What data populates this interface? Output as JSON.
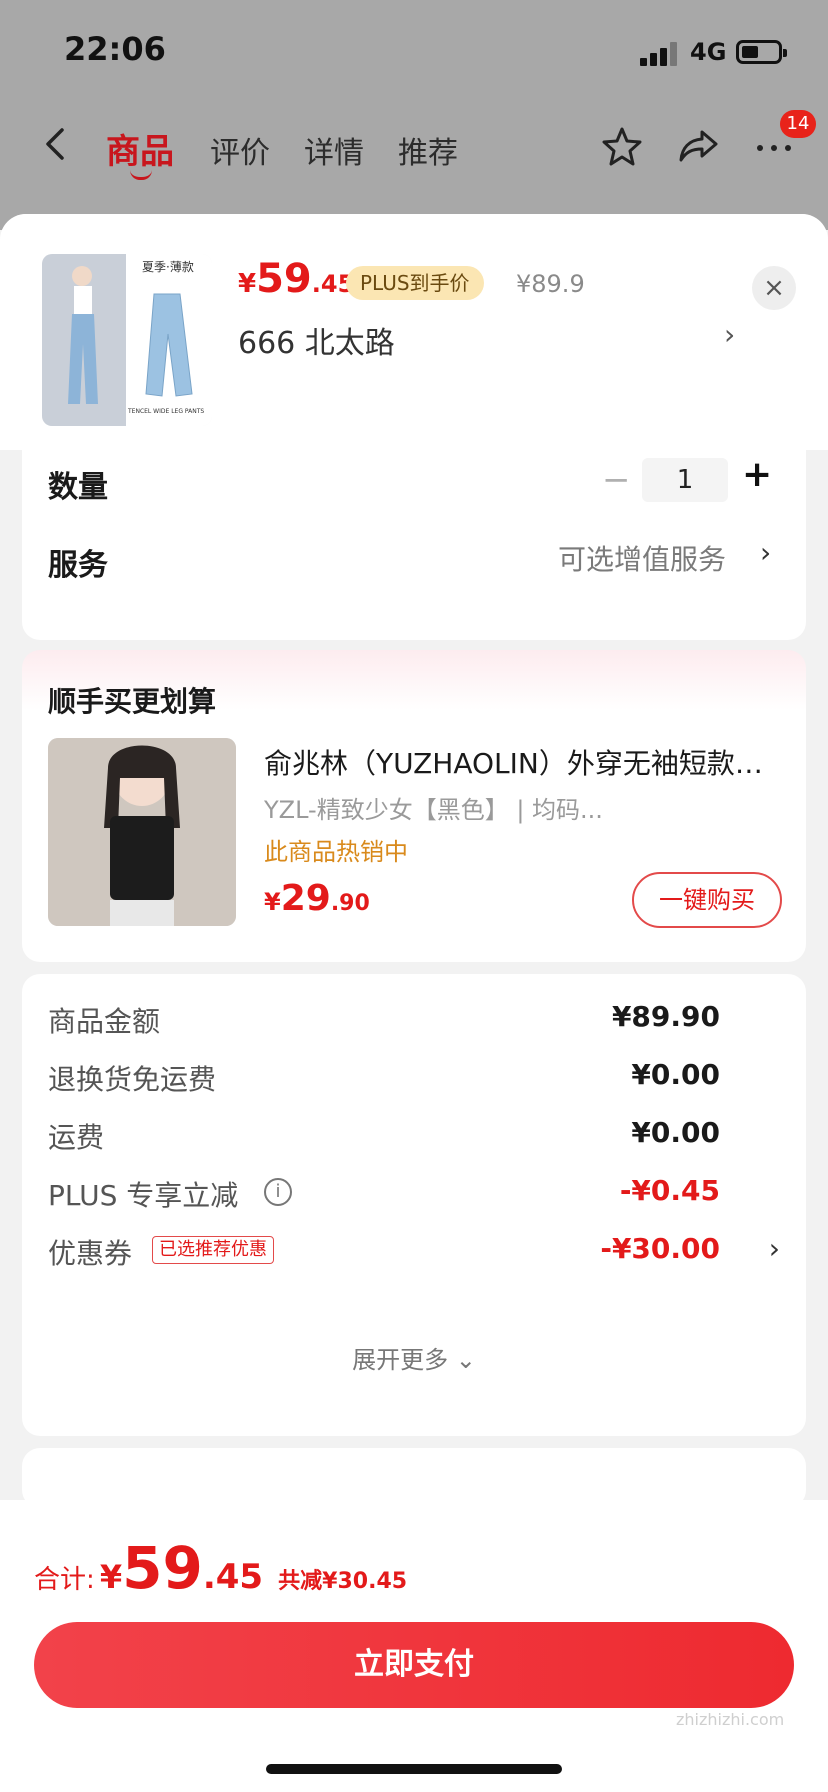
{
  "status": {
    "time": "22:06",
    "network": "4G"
  },
  "nav": {
    "tabs": [
      "商品",
      "评价",
      "详情",
      "推荐"
    ],
    "badge": "14"
  },
  "product": {
    "thumb_caption": "夏季·薄款",
    "thumb_sub": "TENCEL WIDE LEG PANTS",
    "price_currency": "¥",
    "price_int": "59",
    "price_dec": ".45",
    "plus_tag": "PLUS到手价",
    "orig_price": "¥89.9",
    "address": "666  北太路",
    "close": "×"
  },
  "quantity": {
    "label": "数量",
    "minus": "−",
    "value": "1",
    "plus": "+"
  },
  "service": {
    "label": "服务",
    "value": "可选增值服务"
  },
  "upsell": {
    "title": "顺手买更划算",
    "name": "俞兆林（YUZHAOLIN）外穿无袖短款…",
    "spec": "YZL-精致少女【黑色】  |  均码...",
    "hot": "此商品热销中",
    "price_currency": "¥",
    "price_int": "29",
    "price_dec": ".90",
    "buy_label": "一键购买"
  },
  "summary": {
    "rows": [
      {
        "label": "商品金额",
        "value": "¥89.90"
      },
      {
        "label": "退换货免运费",
        "value": "¥0.00"
      },
      {
        "label": "运费",
        "value": "¥0.00"
      },
      {
        "label": "PLUS 专享立减",
        "value": "-¥0.45"
      },
      {
        "label": "优惠券",
        "tag": "已选推荐优惠",
        "value": "-¥30.00"
      }
    ],
    "expand": "展开更多 ⌄"
  },
  "footer": {
    "total_label": "合计:",
    "currency": "¥",
    "total_int": "59",
    "total_dec": ".45",
    "saving": "共减¥30.45",
    "pay_label": "立即支付",
    "watermark": "zhizhizhi.com"
  },
  "colors": {
    "accent": "#e31a1a",
    "plus_tag_bg": "#fbe6b3",
    "hot": "#d98a1c"
  }
}
